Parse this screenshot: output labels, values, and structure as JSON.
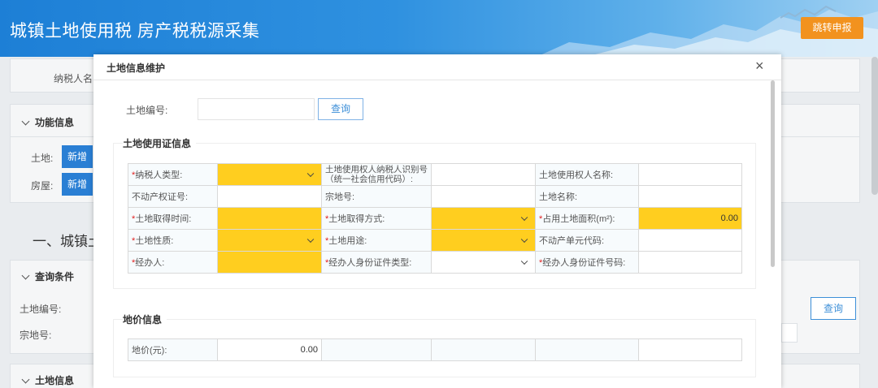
{
  "header": {
    "title": "城镇土地使用税 房产税税源采集",
    "jump_button": "跳转申报"
  },
  "background": {
    "taxpayer_label": "纳税人名",
    "func_section": "功能信息",
    "land_label": "土地:",
    "house_label": "房屋:",
    "add_button": "新增",
    "heading": "一、城镇土",
    "query_section": "查询条件",
    "land_no_label": "土地编号:",
    "parcel_label": "宗地号:",
    "query_button": "查询",
    "land_info_section": "土地信息"
  },
  "modal": {
    "title": "土地信息维护",
    "close": "×",
    "land_no_label": "土地编号:",
    "land_no_value": "",
    "query_button": "查询",
    "cert_section": "土地使用证信息",
    "rows": [
      [
        {
          "label": "纳税人类型:",
          "req": true,
          "value": "",
          "yellow": true,
          "select": true
        },
        {
          "label": "土地使用权人纳税人识别号（统一社会信用代码）:",
          "req": false,
          "value": "",
          "yellow": false,
          "select": false,
          "two": true
        },
        {
          "label": "土地使用权人名称:",
          "req": false,
          "value": "",
          "yellow": false,
          "select": false
        }
      ],
      [
        {
          "label": "不动产权证号:",
          "req": false,
          "value": "",
          "yellow": false,
          "select": false
        },
        {
          "label": "宗地号:",
          "req": false,
          "value": "",
          "yellow": false,
          "select": false
        },
        {
          "label": "土地名称:",
          "req": false,
          "value": "",
          "yellow": false,
          "select": false
        }
      ],
      [
        {
          "label": "土地取得时间:",
          "req": true,
          "value": "",
          "yellow": true,
          "select": false
        },
        {
          "label": "土地取得方式:",
          "req": true,
          "value": "",
          "yellow": true,
          "select": true
        },
        {
          "label": "占用土地面积(m²):",
          "req": true,
          "value": "0.00",
          "yellow": true,
          "select": false
        }
      ],
      [
        {
          "label": "土地性质:",
          "req": true,
          "value": "",
          "yellow": true,
          "select": true
        },
        {
          "label": "土地用途:",
          "req": true,
          "value": "",
          "yellow": true,
          "select": true
        },
        {
          "label": "不动产单元代码:",
          "req": false,
          "value": "",
          "yellow": false,
          "select": false
        }
      ],
      [
        {
          "label": "经办人:",
          "req": true,
          "value": "",
          "yellow": true,
          "select": false
        },
        {
          "label": "经办人身份证件类型:",
          "req": true,
          "value": "",
          "yellow": false,
          "select": true
        },
        {
          "label": "经办人身份证件号码:",
          "req": true,
          "value": "",
          "yellow": false,
          "select": false
        }
      ]
    ],
    "price_section": "地价信息",
    "price_label": "地价(元):",
    "price_value": "0.00"
  }
}
